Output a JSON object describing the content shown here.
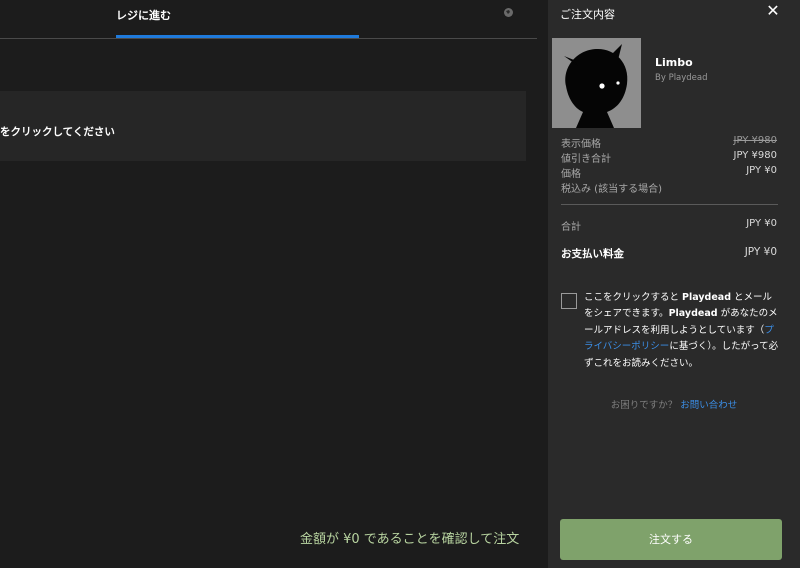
{
  "tabs": {
    "active_label": "レジに進む"
  },
  "notice": {
    "text": "をクリックしてください"
  },
  "confirm_hint": "金額が ¥0 であることを確認して注文",
  "panel": {
    "title": "ご注文内容",
    "close_glyph": "✕",
    "game": {
      "title": "Limbo",
      "publisher": "By Playdead"
    },
    "rows": [
      {
        "label": "表示価格",
        "value": "JPY ¥980",
        "strike": true
      },
      {
        "label": "値引き合計",
        "value": "JPY ¥980"
      },
      {
        "label": "価格",
        "value": "JPY ¥0"
      },
      {
        "label": "税込み (該当する場合)",
        "value": ""
      }
    ],
    "total": {
      "label": "合計",
      "value": "JPY ¥0"
    },
    "payable": {
      "label": "お支払い料金",
      "value": "JPY ¥0"
    },
    "consent": {
      "part1": "ここをクリックすると ",
      "publisher1": "Playdead",
      "part2": " とメールをシェアできます。",
      "publisher2": "Playdead",
      "part3": " があなたのメールアドレスを利用しようとしています（",
      "privacy_link": "プライバシーポリシー",
      "part4": "に基づく）。したがって必ずこれをお読みください。"
    },
    "help": {
      "question": "お困りですか？",
      "link": "お問い合わせ"
    },
    "order_button": "注文する"
  },
  "icons": {
    "globe": "globe-icon",
    "close": "close-icon",
    "checkbox": "checkbox-icon"
  }
}
